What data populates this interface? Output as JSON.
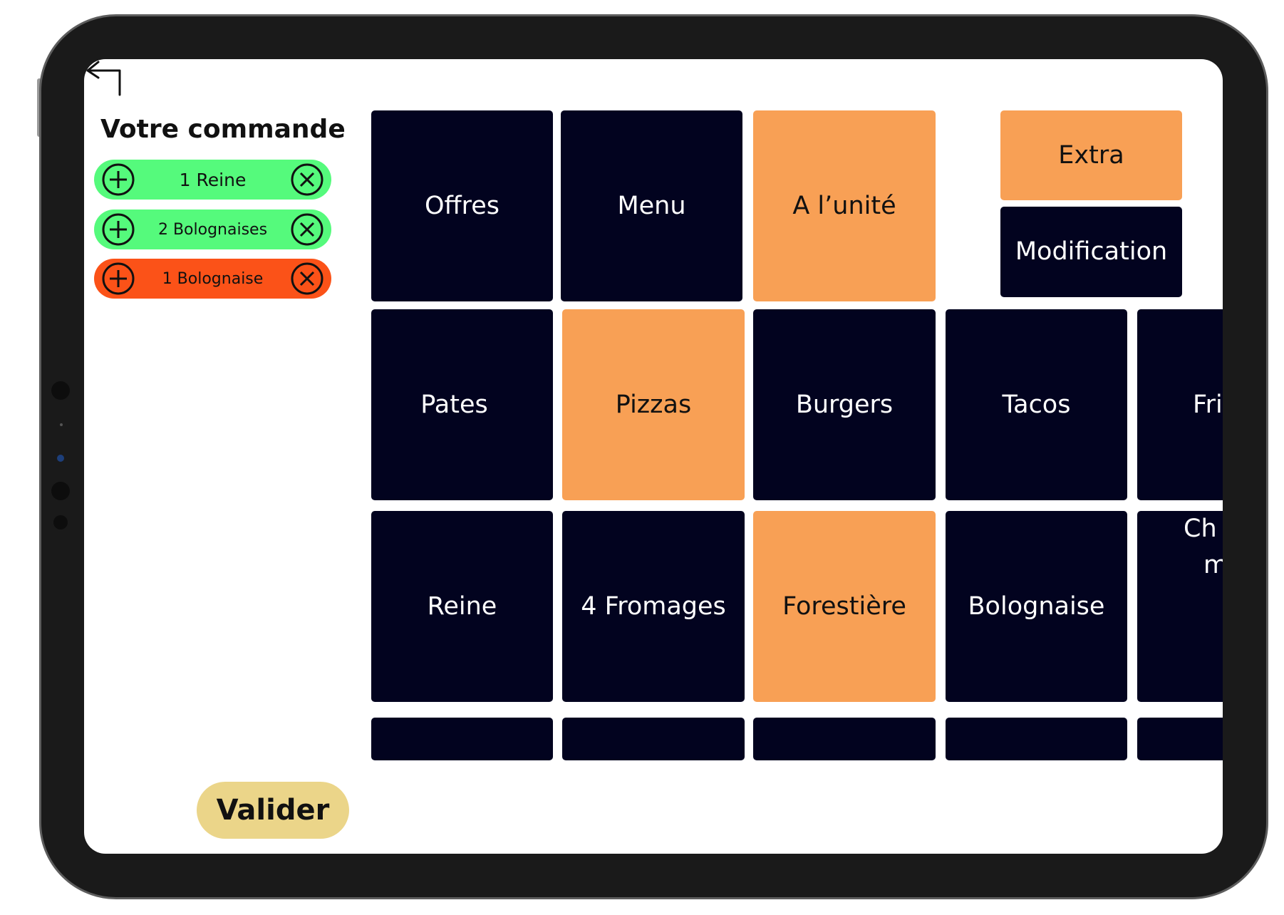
{
  "order": {
    "title": "Votre commande",
    "items": [
      {
        "label": "1 Reine",
        "color": "#55fa7c"
      },
      {
        "label": "2 Bolognaises",
        "color": "#55fa7c"
      },
      {
        "label": "1 Bolognaise",
        "color": "#fb5218"
      }
    ],
    "validate_label": "Valider"
  },
  "tabs": {
    "offres": "Offres",
    "menu": "Menu",
    "unite": "A l’unité",
    "extra": "Extra",
    "modification": "Modification"
  },
  "categories": {
    "pates": "Pates",
    "pizzas": "Pizzas",
    "burgers": "Burgers",
    "tacos": "Tacos",
    "frites_partial": "Fri"
  },
  "products": {
    "reine": "Reine",
    "fromages": "4 Fromages",
    "forestiere": "Forestière",
    "bolognaise": "Bolognaise",
    "partial_line1": "Ch",
    "partial_line2": "m"
  },
  "colors": {
    "tile_dark": "#02031f",
    "tile_selected": "#f8a055",
    "validate": "#ebd589"
  }
}
